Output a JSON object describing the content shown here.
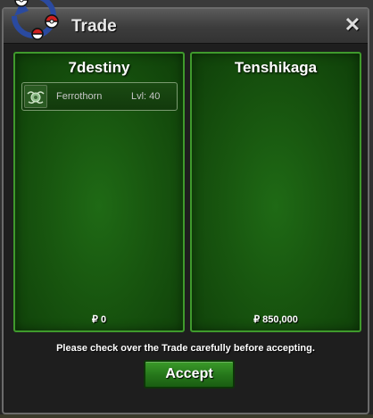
{
  "window": {
    "title": "Trade",
    "close_glyph": "✕"
  },
  "left_panel": {
    "player_name": "7destiny",
    "pokemon": [
      {
        "name": "Ferrothorn",
        "level": "Lvl: 40",
        "icon": "ferrothorn-icon"
      }
    ],
    "money": "₽ 0"
  },
  "right_panel": {
    "player_name": "Tenshikaga",
    "pokemon": [],
    "money": "₽ 850,000"
  },
  "notice": "Please check over the Trade carefully before accepting.",
  "accept_label": "Accept",
  "colors": {
    "panel_border": "#3f9a2c",
    "panel_bg": "#18560f",
    "button_green": "#25751a",
    "titlebar": "#3c3c3c"
  }
}
